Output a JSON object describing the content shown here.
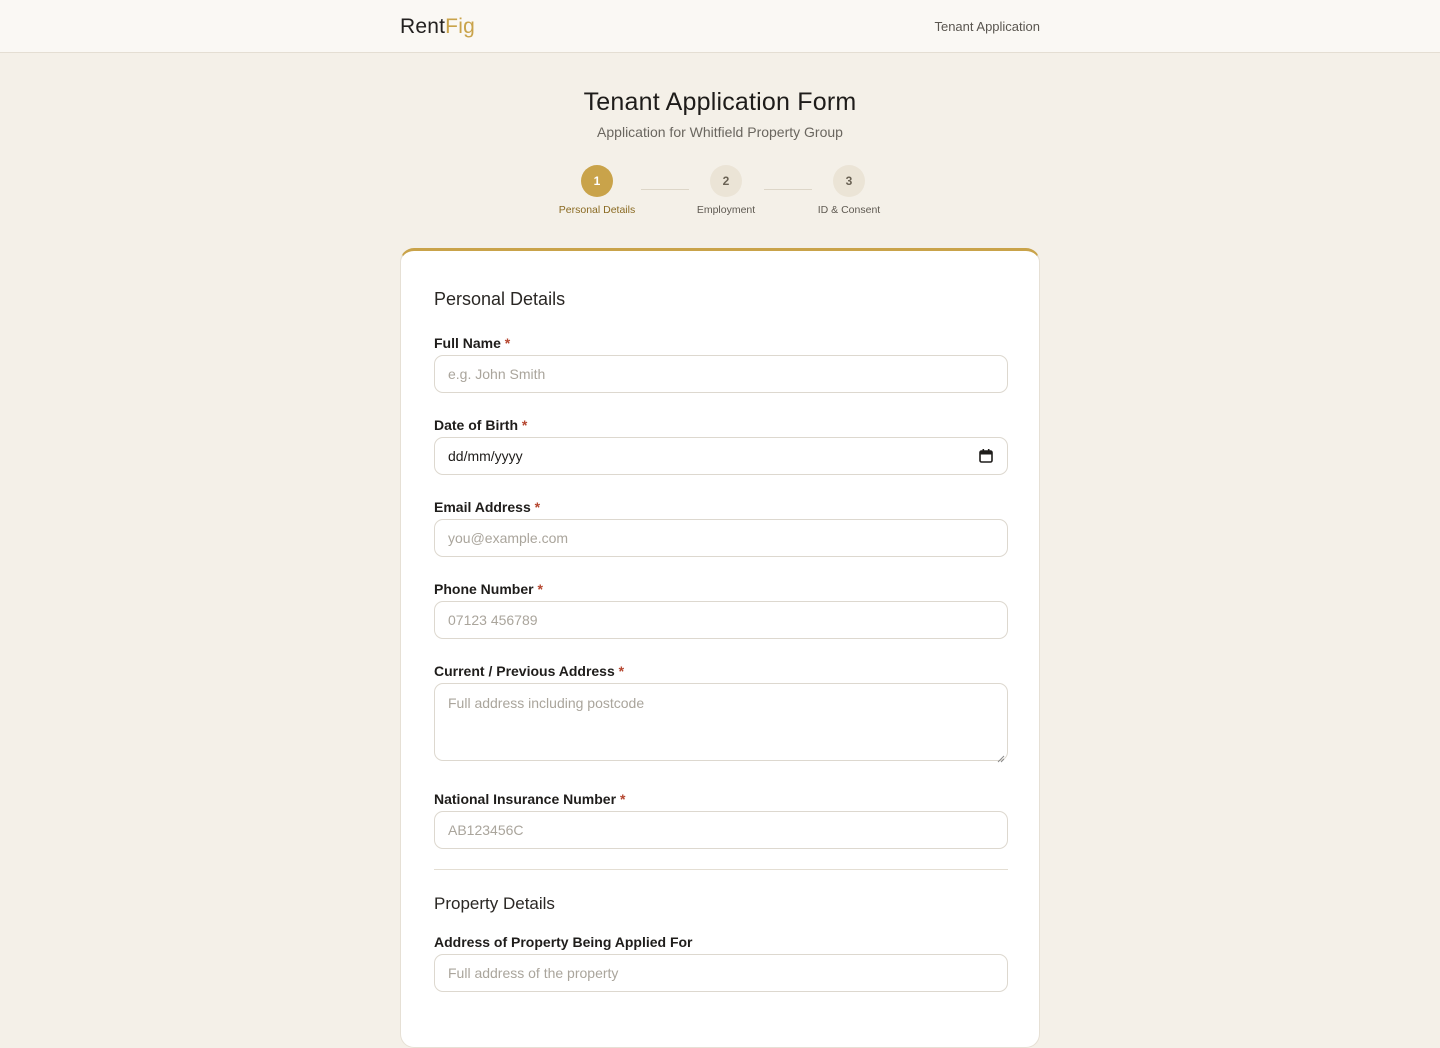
{
  "header": {
    "brand_main": "Rent",
    "brand_accent": "Fig",
    "nav_link": "Tenant Application"
  },
  "page": {
    "title": "Tenant Application Form",
    "subtitle": "Application for Whitfield Property Group"
  },
  "stepper": {
    "steps": [
      {
        "number": "1",
        "label": "Personal Details",
        "active": true
      },
      {
        "number": "2",
        "label": "Employment",
        "active": false
      },
      {
        "number": "3",
        "label": "ID & Consent",
        "active": false
      }
    ]
  },
  "personal_section": {
    "title": "Personal Details",
    "required_marker": "*",
    "full_name": {
      "label": "Full Name",
      "placeholder": "e.g. John Smith"
    },
    "dob": {
      "label": "Date of Birth",
      "value": "dd/mm/yyyy"
    },
    "email": {
      "label": "Email Address",
      "placeholder": "you@example.com"
    },
    "phone": {
      "label": "Phone Number",
      "placeholder": "07123 456789"
    },
    "address": {
      "label": "Current / Previous Address",
      "placeholder": "Full address including postcode"
    },
    "ni_number": {
      "label": "National Insurance Number",
      "placeholder": "AB123456C"
    }
  },
  "property_section": {
    "title": "Property Details",
    "property_address": {
      "label": "Address of Property Being Applied For",
      "placeholder": "Full address of the property"
    }
  },
  "colors": {
    "accent": "#c9a34a",
    "background": "#f4f0e8",
    "required": "#b5462f"
  },
  "icons": [
    "calendar-icon",
    "resize-grip-icon"
  ]
}
